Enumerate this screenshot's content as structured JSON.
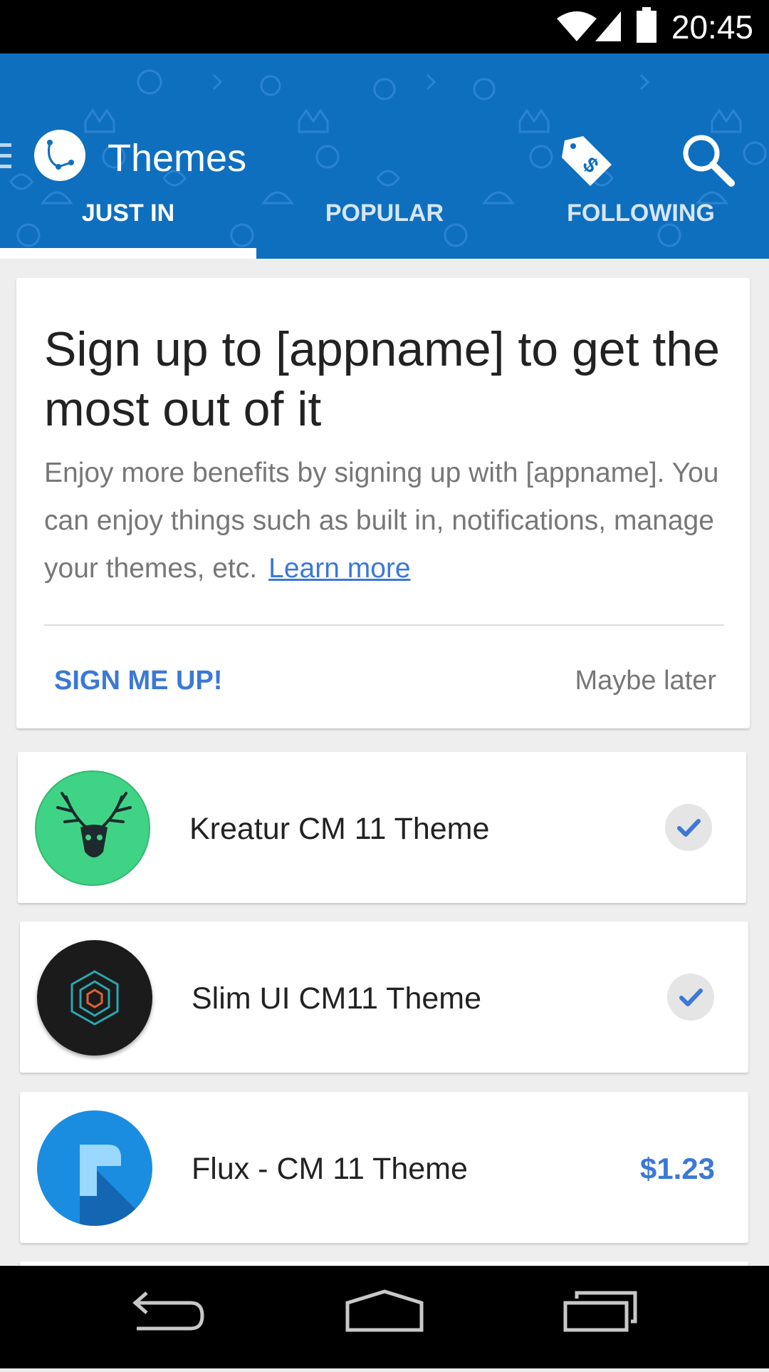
{
  "status_bar": {
    "time": "20:45"
  },
  "app_bar": {
    "title": "Themes"
  },
  "tabs": [
    {
      "label": "JUST IN",
      "active": true
    },
    {
      "label": "POPULAR",
      "active": false
    },
    {
      "label": "FOLLOWING",
      "active": false
    }
  ],
  "signup_card": {
    "title": "Sign up to [appname] to get the most out of it",
    "body": "Enjoy more benefits by signing up with [appname]. You can enjoy things such as built in, notifications, manage your themes, etc.",
    "learn_more": "Learn more",
    "primary_button": "SIGN ME UP!",
    "secondary_button": "Maybe later"
  },
  "themes": [
    {
      "name": "Kreatur CM 11 Theme",
      "status": "installed"
    },
    {
      "name": "Slim UI CM11 Theme",
      "status": "installed"
    },
    {
      "name": "Flux - CM 11 Theme",
      "price": "$1.23"
    }
  ],
  "colors": {
    "primary": "#0f6fbf",
    "accent": "#3b78d8",
    "status_bar": "#000000"
  }
}
